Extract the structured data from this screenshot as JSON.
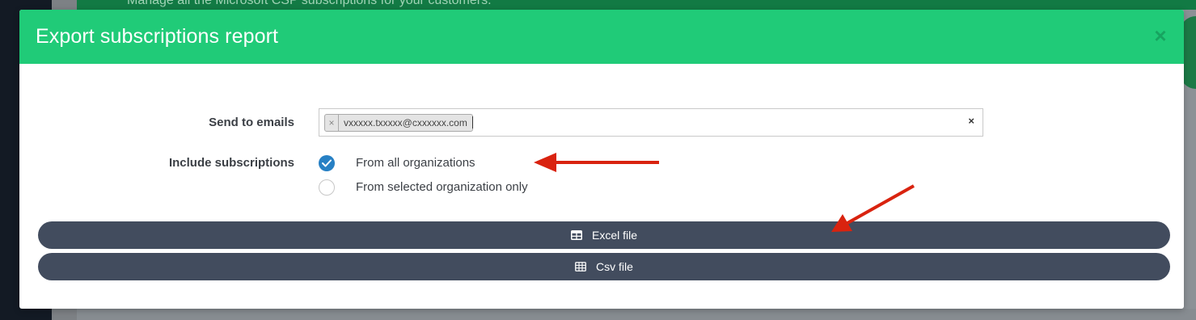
{
  "background": {
    "header_text": "Manage all the Microsoft CSP subscriptions for your customers."
  },
  "modal": {
    "title": "Export subscriptions report",
    "close_glyph": "×"
  },
  "form": {
    "send_to_emails_label": "Send to emails",
    "emails": [
      {
        "remove_glyph": "×",
        "value": "vxxxxx.txxxxx@cxxxxxx.com"
      }
    ],
    "clear_glyph": "×",
    "include_subscriptions_label": "Include subscriptions",
    "options": [
      {
        "label": "From all organizations",
        "checked": true
      },
      {
        "label": "From selected organization only",
        "checked": false
      }
    ]
  },
  "buttons": {
    "excel": {
      "label": "Excel file",
      "icon": "table-icon"
    },
    "csv": {
      "label": "Csv file",
      "icon": "grid-icon"
    }
  },
  "colors": {
    "header_green": "#20cb78",
    "button_dark": "#424c5e",
    "radio_blue": "#2780c4",
    "arrow_red": "#d9230f"
  }
}
